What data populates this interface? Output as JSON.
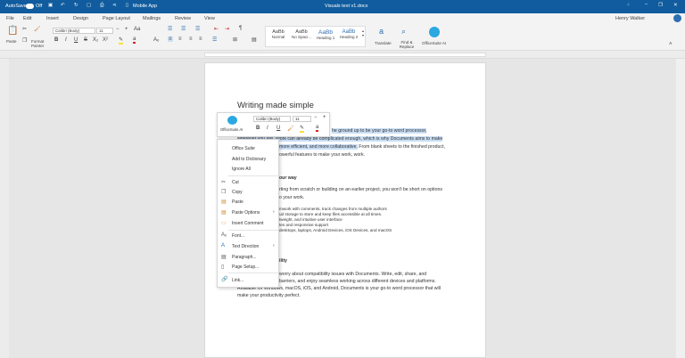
{
  "titlebar": {
    "autosave": "AutoSave",
    "autosave_state": "Off",
    "mobile_app": "Mobile App",
    "title": "Visuals text v1.docx"
  },
  "menu": [
    "File",
    "Edit",
    "Insert",
    "Design",
    "Page Layout",
    "Mailings",
    "Review",
    "View"
  ],
  "user": "Henry Walker",
  "ribbon": {
    "paste": "Paste",
    "format_painter": "Format Painter",
    "font": "Calibri (Body)",
    "size": "11",
    "styles": [
      {
        "preview": "AaBb",
        "name": "Normal"
      },
      {
        "preview": "AaBb",
        "name": "No Spaci..."
      },
      {
        "preview": "AaBb",
        "name": "Heading 1"
      },
      {
        "preview": "AaBb",
        "name": "Heading 2"
      }
    ],
    "translate": "Translate",
    "find_replace": "Find & Replace",
    "ai": "OfficeSuite AI"
  },
  "mini": {
    "ai": "OfficeSuite AI",
    "font": "Calibri (Body)",
    "size": "11"
  },
  "context_menu": {
    "suggestion": "Office Suite",
    "add_dict": "Add to Dictionary",
    "ignore_all": "Ignore All",
    "cut": "Cut",
    "copy": "Copy",
    "paste": "Paste",
    "paste_options": "Paste Options",
    "insert_comment": "Insert Comment",
    "font": "Font...",
    "text_direction": "Text Direction",
    "paragraph": "Paragraph...",
    "page_setup": "Page Setup...",
    "link": "Link..."
  },
  "doc": {
    "title": "Writing made simple",
    "p1": [
      "he ground up to be your go-to word processor,",
      "wherever you are. Work can already be complicated enough, which is why Documents aims to make",
      "more efficient, and more collaborative.",
      " From blank sheets to the finished product,",
      "owerful features to make your work, work."
    ],
    "h2": "our way",
    "p2": [
      "rting from scratch or building on an earlier project, you won't be short on options",
      "o your work."
    ],
    "bullets": [
      "mwork with comments, track changes from multiple authors",
      "ud storage to store and keep files accessible at all times.",
      "tweight, and intuitive user interface",
      "tes and responsive support",
      "desktops, laptops, Android Devices, iOS Devices, and macOS"
    ],
    "h3": "ility",
    "p3": [
      "worry about compatibility issues with Documents. Write, edit, share, and",
      "barriers, and enjoy seamless working across different devices and platforms.",
      "Available for Windows, macOS, iOS, and Android, Documents is your go-to word processor that will",
      "make your productivity perfect."
    ]
  }
}
